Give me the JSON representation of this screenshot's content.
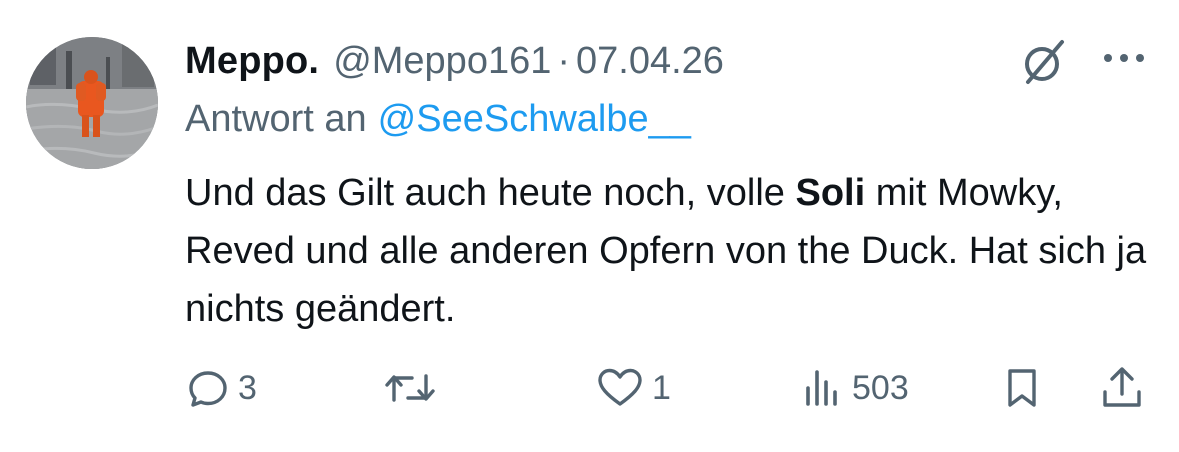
{
  "tweet": {
    "author": {
      "display_name": "Meppo.",
      "handle": "@Meppo161"
    },
    "separator": "·",
    "date": "07.04.26",
    "reply": {
      "prefix": "Antwort an",
      "handle": "@SeeSchwalbe__"
    },
    "text": {
      "before": "Und das Gilt auch heute noch, volle ",
      "bold": "Soli",
      "after": " mit Mowky, Reved und alle anderen Opfern von the Duck. Hat sich ja nichts geändert."
    },
    "actions": {
      "replies": "3",
      "likes": "1",
      "views": "503"
    }
  },
  "icons": {
    "header_right": [
      "grok-icon",
      "more-icon"
    ],
    "actions": [
      "reply-icon",
      "retweet-icon",
      "like-icon",
      "views-icon",
      "bookmark-icon",
      "share-icon"
    ]
  },
  "colors": {
    "text_primary": "#0f1419",
    "text_secondary": "#536471",
    "link": "#1d9bf0"
  }
}
